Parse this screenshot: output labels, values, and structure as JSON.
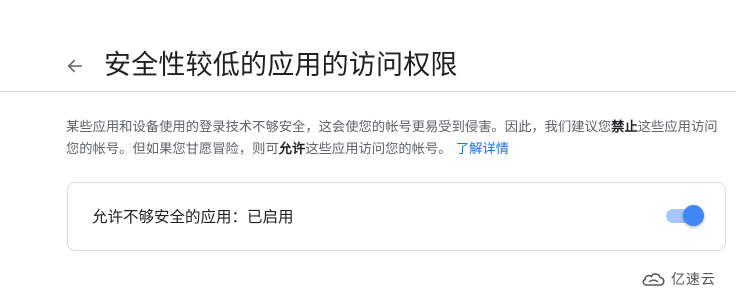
{
  "header": {
    "title": "安全性较低的应用的访问权限"
  },
  "description": {
    "part1": "某些应用和设备使用的登录技术不够安全，这会使您的帐号更易受到侵害。因此，我们建议您",
    "bold1": "禁止",
    "part2": "这些应用访问您的帐号。但如果您甘愿冒险，则可",
    "bold2": "允许",
    "part3": "这些应用访问您的帐号。",
    "learn_more": "了解详情"
  },
  "setting": {
    "label": "允许不够安全的应用：已启用",
    "enabled": true,
    "accent_color": "#4285f4",
    "track_color": "#a8c7fa"
  },
  "watermark": {
    "text": "亿速云"
  }
}
